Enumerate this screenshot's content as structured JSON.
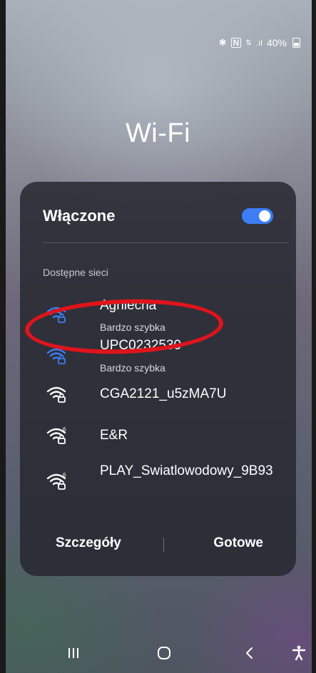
{
  "status_bar": {
    "icons": [
      "bluetooth-icon",
      "nfc-icon",
      "data-signal-icon",
      "cell-signal-icon"
    ],
    "battery": "40%"
  },
  "title": "Wi-Fi",
  "toggle": {
    "label": "Włączone",
    "on": true,
    "accent": "#3d7ef5"
  },
  "section_label": "Dostępne sieci",
  "networks": [
    {
      "name": "Agniecha",
      "subtitle": "Bardzo szybka",
      "icon": "wifi-lock-icon",
      "connected_style": "#3d7ef5"
    },
    {
      "name": "UPC0232530",
      "subtitle": "Bardzo szybka",
      "icon": "wifi-lock-icon",
      "connected_style": "#3d7ef5"
    },
    {
      "name": "CGA2121_u5zMA7U",
      "subtitle": "",
      "icon": "wifi-lock-icon"
    },
    {
      "name": "E&R",
      "subtitle": "",
      "icon": "wifi6-lock-icon"
    },
    {
      "name": "PLAY_Swiatlowodowy_9B93",
      "subtitle": "",
      "icon": "wifi6-lock-icon"
    }
  ],
  "annotation_color": "#e0141b",
  "actions": {
    "details": "Szczegóły",
    "done": "Gotowe"
  },
  "nav": [
    "recents-icon",
    "home-icon",
    "back-icon",
    "accessibility-icon"
  ]
}
